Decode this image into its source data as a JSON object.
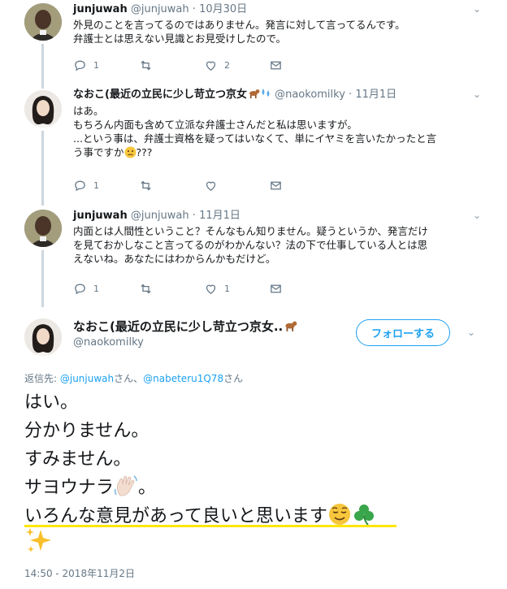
{
  "tweets": [
    {
      "name": "junjuwah",
      "handle": "@junjuwah",
      "sep": "·",
      "date": "10月30日",
      "text_lines": [
        "外見のことを言ってるのではありません。発言に対して言ってるんです。",
        "弁護士とは思えない見識とお見受けしたので。"
      ],
      "replies": "1",
      "retweets": "",
      "likes": "2"
    },
    {
      "name": "なおこ(最近の立民に少し苛立つ京女",
      "handle": "@naokomilky",
      "sep": "·",
      "date": "11月1日",
      "text_lines": [
        "はあ。",
        "もちろん内面も含めて立派な弁護士さんだと私は思いますが。",
        "...という事は、弁護士資格を疑ってはいなくて、単にイヤミを言いたかったと言",
        "う事ですか"
      ],
      "text_suffix": "???",
      "replies": "1",
      "retweets": "",
      "likes": ""
    },
    {
      "name": "junjuwah",
      "handle": "@junjuwah",
      "sep": "·",
      "date": "11月1日",
      "text_lines": [
        "内面とは人間性ということ？そんなもん知りません。疑うというか、発言だけ",
        "を見ておかしなこと言ってるのがわかんない？法の下で仕事している人とは思",
        "えないね。あなたにはわからんかもだけど。"
      ],
      "replies": "1",
      "retweets": "",
      "likes": "1"
    }
  ],
  "main": {
    "name": "なおこ(最近の立民に少し苛立つ京女..",
    "handle": "@naokomilky",
    "follow_label": "フォローする",
    "reply_prefix": "返信先: ",
    "reply_user1": "@junjuwah",
    "reply_mid": "さん、",
    "reply_user2": "@nabeteru1Q78",
    "reply_suffix": "さん",
    "lines": [
      "はい。",
      "分かりません。",
      "すみません。",
      "サヨウナラ",
      "いろんな意見があって良いと思います"
    ],
    "line4_suffix": "。",
    "timestamp": "14:50 - 2018年11月2日"
  },
  "icons": [
    "reply-icon",
    "retweet-icon",
    "like-icon",
    "dm-icon",
    "caret-down-icon",
    "dog-emoji",
    "sweat-emoji",
    "confused-face-emoji",
    "waving-hand-emoji",
    "relieved-face-emoji",
    "shamrock-emoji",
    "sparkles-emoji"
  ],
  "colors": {
    "accent": "#1da1f2",
    "muted": "#657786",
    "thread": "#ccd6dd",
    "highlight": "#ffe500"
  }
}
